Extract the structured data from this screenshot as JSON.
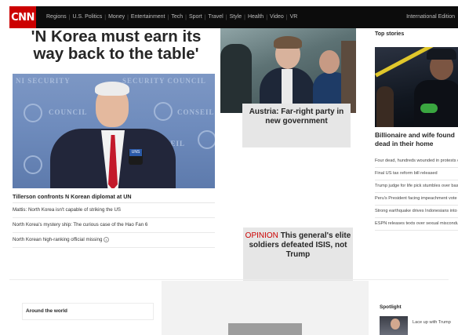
{
  "header": {
    "logo": "CNN",
    "nav": [
      "Regions",
      "U.S. Politics",
      "Money",
      "Entertainment",
      "Tech",
      "Sport",
      "Travel",
      "Style",
      "Health",
      "Video",
      "VR"
    ],
    "edition": "International Edition"
  },
  "main": {
    "headline": "'N Korea must earn its way back to the table'",
    "hero_image": {
      "wall_text_1": "NI SECURITY",
      "wall_text_2": "SECURITY COUNCIL",
      "wall_text_3": "COUNCIL",
      "wall_text_4": "NSEIL",
      "wall_text_5": "CONSEIL",
      "mic_flag": "UNS"
    },
    "lead_link": "Tillerson confronts N Korean diplomat at UN",
    "links": [
      "Mattis: North Korea isn't capable of striking the US",
      "North Korea's mystery ship: The curious case of the Hao Fan 6",
      "North Korean high-ranking official missing"
    ]
  },
  "middle": {
    "austria_card": "Austria: Far-right party in new government",
    "opinion": {
      "label": "OPINION",
      "title": "This general's elite soldiers defeated ISIS, not Trump"
    }
  },
  "right": {
    "section": "Top stories",
    "headline": "Billionaire and wife found dead in their home",
    "stories": [
      "Four dead, hundreds wounded in protests over Trump's Jerusalem move",
      "Final US tax reform bill released",
      "Trump judge for life pick stumbles over basic law questions",
      "Peru's President facing impeachment vote",
      "Strong earthquake drives Indonesians into streets",
      "ESPN releases texts over sexual misconduct allegations"
    ]
  },
  "bottom": {
    "around_the_world": "Around the world",
    "spotlight": "Spotlight",
    "spotlight_text": "Lace up with Trump"
  }
}
